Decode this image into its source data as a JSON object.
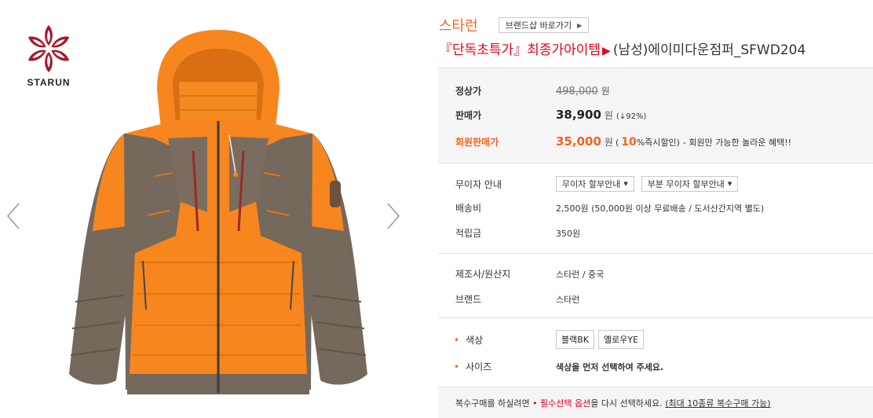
{
  "brand": {
    "name": "스타런",
    "shop_button_label": "브랜드샵 바로가기",
    "logo_text": "STARUN"
  },
  "product": {
    "title_promo": "『단독초특가』최종가아이템",
    "title_main": "(남성)에이미다운점퍼_SFWD204",
    "image_alt": "orange down jacket"
  },
  "price": {
    "regular_label": "정상가",
    "regular_value": "498,000",
    "sale_label": "판매가",
    "sale_value": "38,900",
    "discount": "(↓92%)",
    "member_label": "회원판매가",
    "member_value": "35,000",
    "member_open": "(",
    "member_pct": "10",
    "member_pct_suffix": "%즉시할인)",
    "member_note": "- 회원만 가능한 놀라운 혜택!!",
    "currency": "원"
  },
  "shipping": {
    "installment_label": "무이자 안내",
    "installment_btn1": "무이자 할부안내",
    "installment_btn2": "부분 무이자 할부안내",
    "delivery_label": "배송비",
    "delivery_value": "2,500원 (50,000원 이상 무료배송 / 도서산간지역 별도)",
    "points_label": "적립금",
    "points_value": "350원"
  },
  "maker": {
    "origin_label": "제조사/원산지",
    "origin_value": "스타런 / 중국",
    "brand_label": "브랜드",
    "brand_value": "스타런"
  },
  "options": {
    "color_label": "색상",
    "colors": [
      "블랙BK",
      "옐로우YE"
    ],
    "size_label": "사이즈",
    "size_message": "색상을 먼저 선택하여 주세요."
  },
  "bottom": {
    "text1": "복수구매를 하실려면",
    "text2": " • 필수선택 옵션",
    "text3": "을 다시 선택하세요.",
    "text4": "(최대 10종류 복수구매 가능)"
  },
  "colors": {
    "accent_orange": "#f26522",
    "promo_red": "#e4001c",
    "jacket_orange": "#f7861e",
    "jacket_grey": "#75685c"
  }
}
